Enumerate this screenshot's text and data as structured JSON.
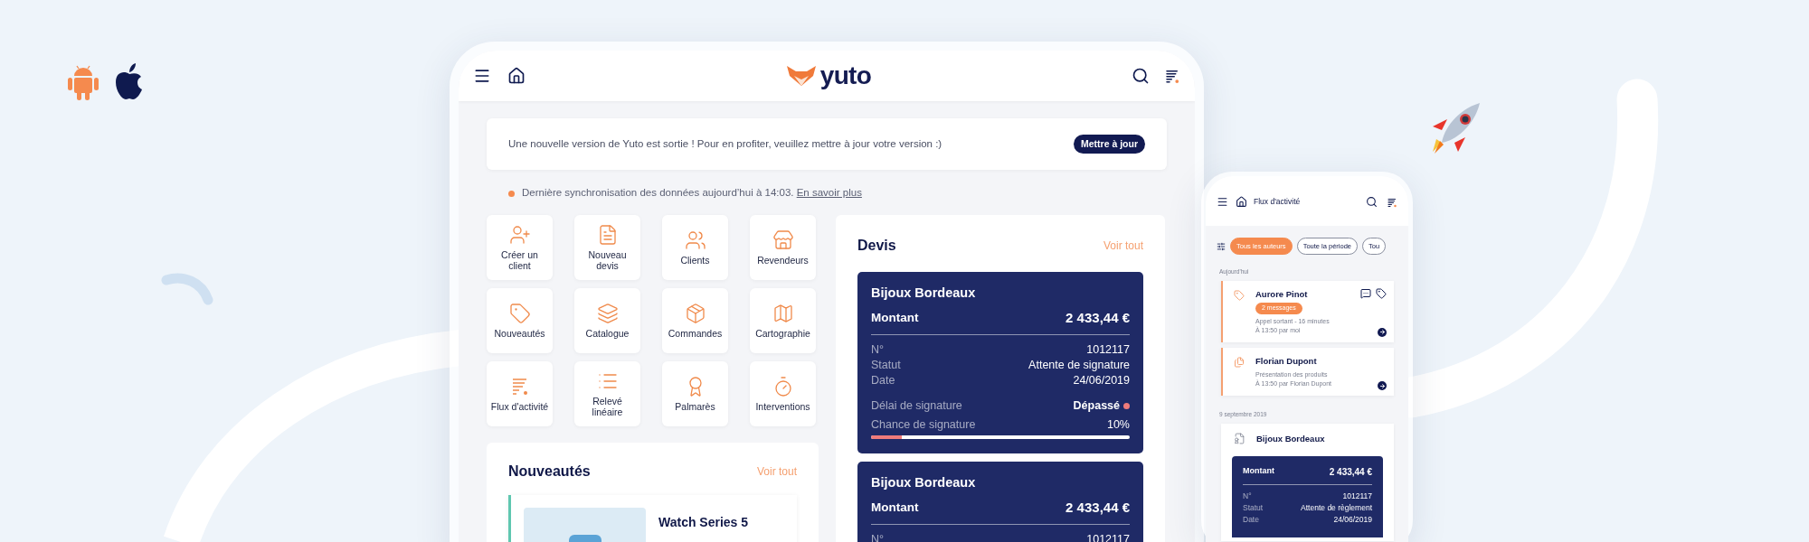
{
  "tablet": {
    "header": {
      "logo_text": "yuto"
    },
    "update_banner": {
      "message": "Une nouvelle version de Yuto est sortie ! Pour en profiter, veuillez mettre à jour votre version :)",
      "button": "Mettre à jour"
    },
    "sync_notice": {
      "text": "Dernière synchronisation des données aujourd’hui à 14:03.",
      "link": "En savoir plus"
    },
    "shortcuts": [
      {
        "label": "Créer un client"
      },
      {
        "label": "Nouveau devis"
      },
      {
        "label": "Clients"
      },
      {
        "label": "Revendeurs"
      },
      {
        "label": "Nouveautés"
      },
      {
        "label": "Catalogue"
      },
      {
        "label": "Commandes"
      },
      {
        "label": "Cartographie"
      },
      {
        "label": "Flux d'activité"
      },
      {
        "label": "Relevé linéaire"
      },
      {
        "label": "Palmarès"
      },
      {
        "label": "Interventions"
      }
    ],
    "news": {
      "title": "Nouveautés",
      "link": "Voir tout",
      "items": [
        {
          "title": "Watch Series 5"
        }
      ]
    },
    "quotes": {
      "title": "Devis",
      "link": "Voir tout",
      "items": [
        {
          "client": "Bijoux Bordeaux",
          "amount_label": "Montant",
          "amount": "2 433,44 €",
          "fields": [
            {
              "label": "N°",
              "value": "1012117"
            },
            {
              "label": "Statut",
              "value": "Attente de signature"
            },
            {
              "label": "Date",
              "value": "24/06/2019"
            }
          ],
          "deadline": {
            "label": "Délai de signature",
            "value": "Dépassé"
          },
          "chance": {
            "label": "Chance de signature",
            "value": "10%",
            "level": 0.12
          }
        },
        {
          "client": "Bijoux Bordeaux",
          "amount_label": "Montant",
          "amount": "2 433,44 €",
          "fields": [
            {
              "label": "N°",
              "value": "1012117"
            }
          ]
        }
      ]
    }
  },
  "phone": {
    "header": {
      "title": "Flux d'activité"
    },
    "filters": [
      {
        "label": "Tous les auteurs",
        "selected": true
      },
      {
        "label": "Toute la période",
        "selected": false
      },
      {
        "label": "Tou",
        "selected": false
      }
    ],
    "sections": [
      {
        "heading": "Aujourd'hui",
        "items": [
          {
            "kind": "call",
            "name": "Aurore Pinot",
            "badge": "2 messages",
            "lines": [
              "Appel sortant - 16 minutes",
              "À 13:50 par moi"
            ]
          },
          {
            "kind": "presentation",
            "name": "Florian Dupont",
            "lines": [
              "Présentation des produits",
              "À 13:50 par Florian Dupont"
            ]
          }
        ]
      },
      {
        "heading": "9 septembre 2019",
        "items": [
          {
            "kind": "quote",
            "name": "Bijoux Bordeaux",
            "amount_label": "Montant",
            "amount": "2 433,44 €",
            "fields": [
              {
                "label": "N°",
                "value": "1012117"
              },
              {
                "label": "Statut",
                "value": "Attente de règlement"
              },
              {
                "label": "Date",
                "value": "24/06/2019"
              }
            ]
          }
        ]
      }
    ]
  }
}
